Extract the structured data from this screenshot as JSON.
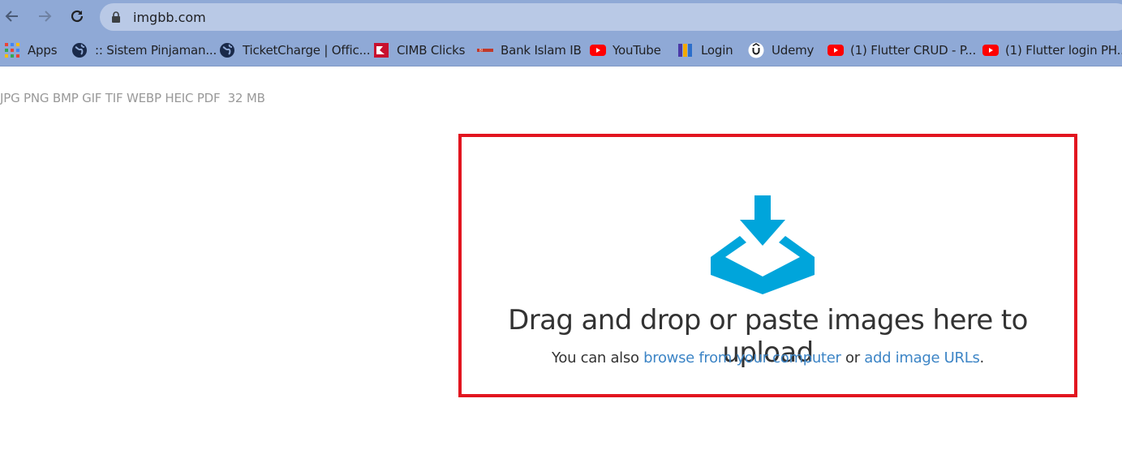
{
  "browser": {
    "url": "imgbb.com",
    "bookmarks": [
      {
        "label": "Apps",
        "icon": "apps-grid-icon"
      },
      {
        "label": ":: Sistem Pinjaman...",
        "icon": "globe-icon"
      },
      {
        "label": "TicketCharge | Offic...",
        "icon": "globe-icon"
      },
      {
        "label": "CIMB Clicks",
        "icon": "cimb-icon"
      },
      {
        "label": "Bank Islam IB",
        "icon": "bank-islam-icon"
      },
      {
        "label": "YouTube",
        "icon": "youtube-icon"
      },
      {
        "label": "Login",
        "icon": "login-icon"
      },
      {
        "label": "Udemy",
        "icon": "udemy-icon"
      },
      {
        "label": "(1) Flutter CRUD - P...",
        "icon": "youtube-icon"
      },
      {
        "label": "(1) Flutter login PH...",
        "icon": "youtube-icon"
      }
    ]
  },
  "page": {
    "formats": "JPG PNG BMP GIF TIF WEBP HEIC PDF",
    "max_size": "32 MB",
    "dropzone": {
      "title": "Drag and drop or paste images here to upload",
      "sub_prefix": "You can also",
      "browse_link": "browse from your computer",
      "or_text": "or",
      "urls_link": "add image URLs",
      "period": "."
    }
  },
  "colors": {
    "toolbar": "#8fa9d6",
    "accent_icon": "#00a5db",
    "link": "#3d85c6",
    "dropzone_border": "#e2151f"
  }
}
